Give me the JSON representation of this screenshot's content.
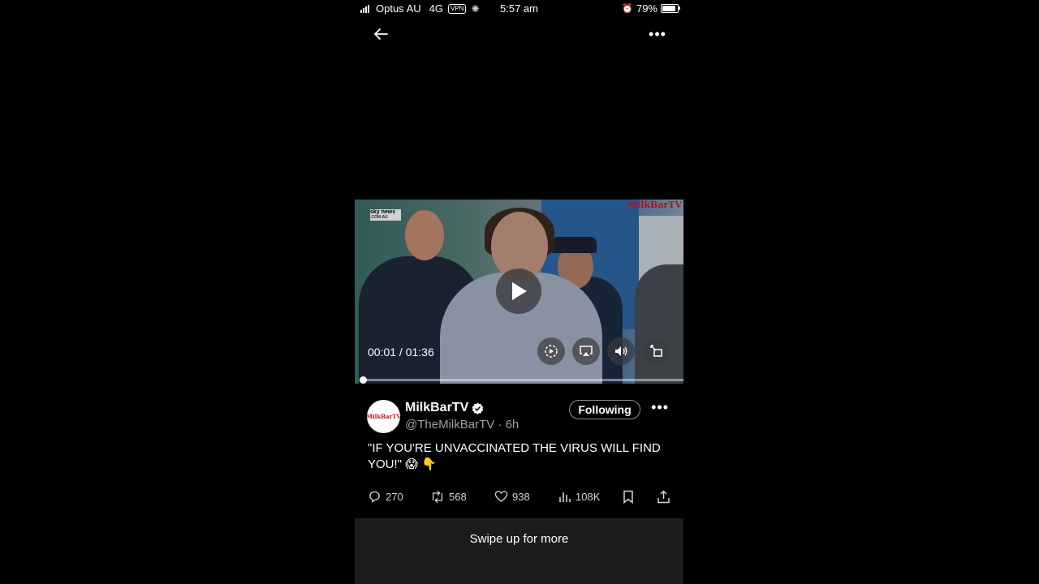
{
  "status_bar": {
    "carrier": "Optus AU",
    "network": "4G",
    "vpn": "VPN",
    "time": "5:57 am",
    "alarm_icon": "alarm-icon",
    "battery": "79%"
  },
  "video": {
    "time_display": "00:01 / 01:36",
    "progress": 0.01,
    "watermark": "MilkBarTV",
    "news_logo_line1": "sky news",
    "news_logo_line2": ".COM.AU"
  },
  "tweet": {
    "avatar_text": "MilkBarTV",
    "display_name": "MilkBarTV",
    "handle_time": "@TheMilkBarTV · 6h",
    "follow_label": "Following",
    "text": "\"IF YOU'RE UNVACCINATED THE VIRUS WILL FIND YOU!\" 😱 👇"
  },
  "actions": {
    "replies": "270",
    "reposts": "568",
    "likes": "938",
    "views": "108K"
  },
  "footer": {
    "swipe_label": "Swipe up for more"
  },
  "colors": {
    "background": "#000000",
    "accent_red": "#e0121b",
    "muted_text": "#9aa0a6",
    "verified_blue": "#1d9bf0"
  }
}
